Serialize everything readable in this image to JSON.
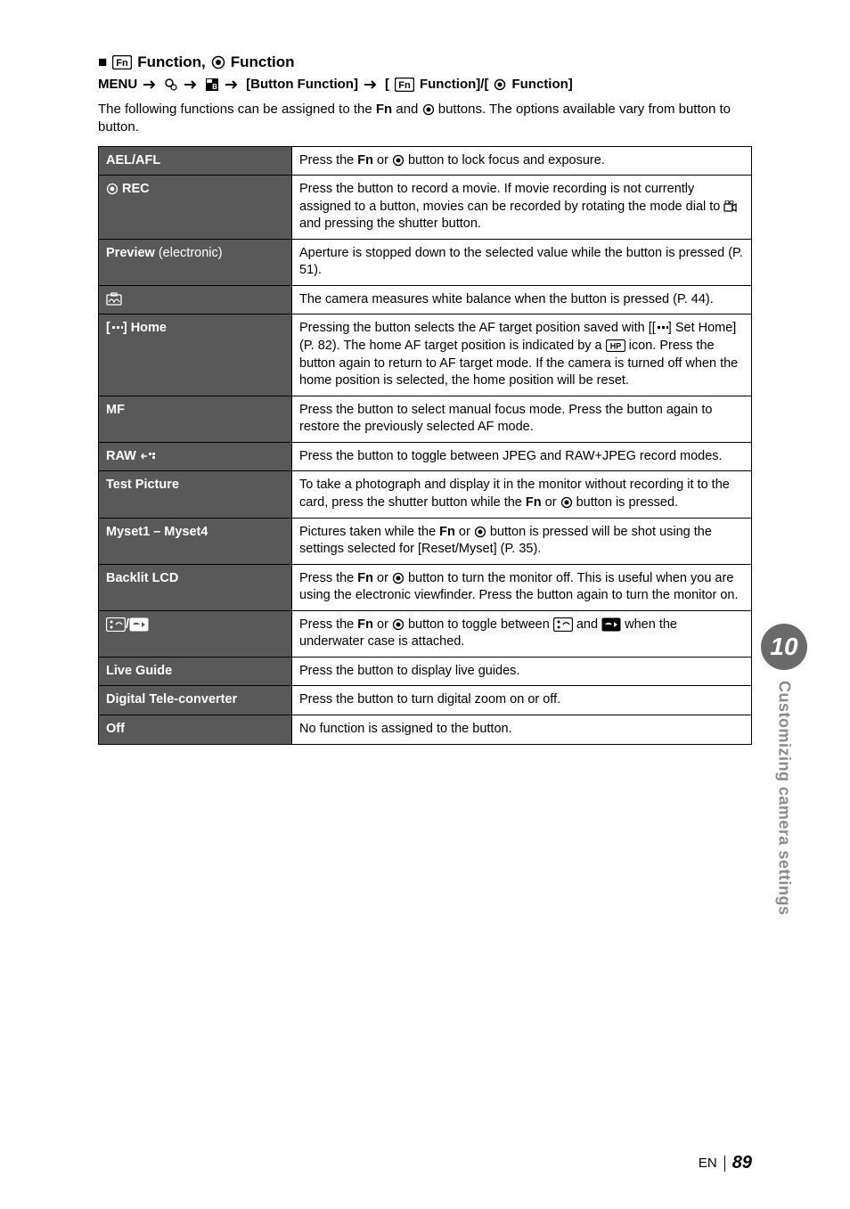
{
  "heading": {
    "bullet": "■",
    "fn_box_text": "Fn",
    "part1": "Function,",
    "part2": "Function"
  },
  "menu_path": {
    "menu_label": "MENU",
    "button_function_label": "[Button Function]",
    "fn_box_text": "Fn",
    "tail": "Function]/[",
    "tail2": "Function]"
  },
  "intro": {
    "pre": "The following functions can be assigned to the ",
    "fn": "Fn",
    "mid": " and ",
    "post": " buttons. The options available vary from button to button."
  },
  "rows": {
    "aelafl": {
      "label": "AEL/AFL",
      "t1": "Press the ",
      "fn": "Fn",
      "t2": " or ",
      "t3": " button to lock focus and exposure."
    },
    "rec": {
      "label": "REC",
      "t1": "Press the button to record a movie. If movie recording is not currently assigned to a button, movies can be recorded by rotating the mode dial to ",
      "t2": " and pressing the shutter button."
    },
    "preview": {
      "label_bold": "Preview",
      "label_normal": " (electronic)",
      "desc": "Aperture is stopped down to the selected value while the button is pressed (P. 51)."
    },
    "wb": {
      "desc": "The camera measures white balance when the button is pressed (P. 44)."
    },
    "home": {
      "label_pre": "[",
      "label_post": "] Home",
      "t1": "Pressing the button selects the AF target position saved with [[",
      "t2": "] Set Home] (P. 82). The home AF target position is indicated by a ",
      "hp": "HP",
      "t3": " icon. Press the button again to return to AF target mode. If the camera is turned off when the home position is selected, the home position will be reset."
    },
    "mf": {
      "label": "MF",
      "desc": "Press the button to select manual focus mode. Press the button again to restore the previously selected AF mode."
    },
    "raw": {
      "label": "RAW",
      "desc": "Press the button to toggle between JPEG and RAW+JPEG record modes."
    },
    "test": {
      "label": "Test Picture",
      "t1": "To take a photograph and display it in the monitor without recording it to the card, press the shutter button while the ",
      "fn": "Fn",
      "t2": " or ",
      "t3": " button is pressed."
    },
    "myset": {
      "label": "Myset1 – Myset4",
      "t1": "Pictures taken while the ",
      "fn": "Fn",
      "t2": " or ",
      "t3": " button is pressed will be shot using the settings selected for [Reset/Myset] (P. 35)."
    },
    "backlit": {
      "label": "Backlit LCD",
      "t1": "Press the ",
      "fn": "Fn",
      "t2": " or ",
      "t3": " button to turn the monitor off. This is useful when you are using the electronic viewfinder. Press the button again to turn the monitor on."
    },
    "underwater": {
      "t1": "Press the ",
      "fn": "Fn",
      "t2": " or ",
      "t3": " button to toggle between ",
      "t4": " and ",
      "t5": " when the underwater case is attached."
    },
    "liveguide": {
      "label": "Live Guide",
      "desc": "Press the button to display live guides."
    },
    "dtc": {
      "label": "Digital Tele-converter",
      "desc": "Press the button to turn digital zoom on or off."
    },
    "off": {
      "label": "Off",
      "desc": "No function is assigned to the button."
    }
  },
  "side_tab": {
    "number": "10",
    "text": "Customizing camera settings"
  },
  "footer": {
    "lang": "EN",
    "page": "89"
  }
}
